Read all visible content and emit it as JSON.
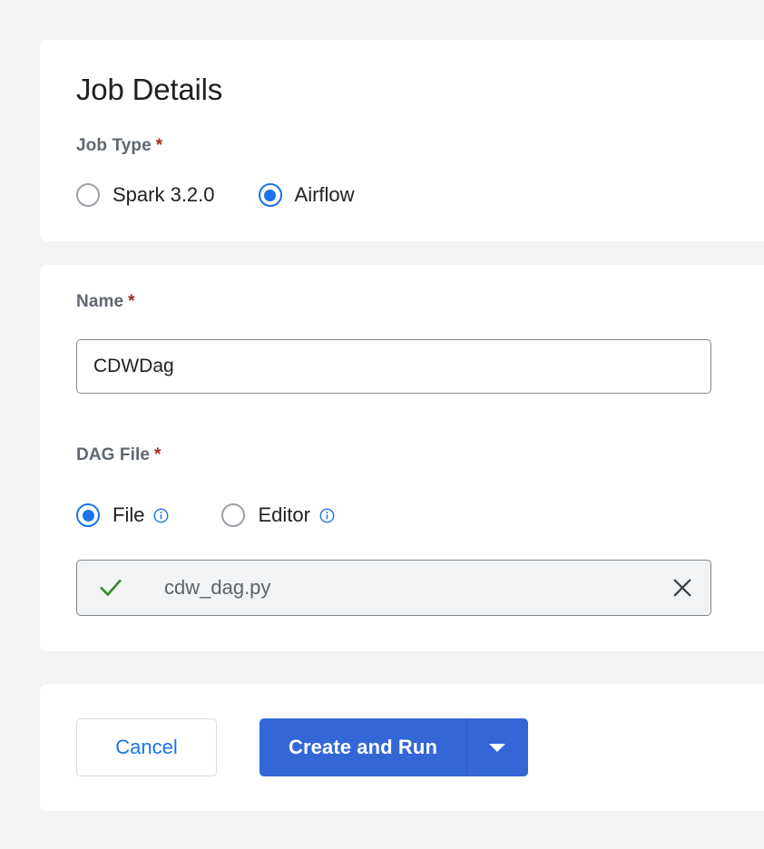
{
  "panel": {
    "title": "Job Details"
  },
  "job_type": {
    "label": "Job Type",
    "required_marker": "*",
    "options": [
      {
        "label": "Spark 3.2.0",
        "selected": false
      },
      {
        "label": "Airflow",
        "selected": true
      }
    ]
  },
  "name_field": {
    "label": "Name",
    "required_marker": "*",
    "value": "CDWDag",
    "placeholder": ""
  },
  "dag_file": {
    "label": "DAG File",
    "required_marker": "*",
    "options": [
      {
        "label": "File",
        "selected": true,
        "info_icon": "info-icon"
      },
      {
        "label": "Editor",
        "selected": false,
        "info_icon": "info-icon"
      }
    ],
    "uploaded": {
      "status_icon": "check-icon",
      "file_name": "cdw_dag.py",
      "remove_icon": "close-icon"
    }
  },
  "footer": {
    "cancel_label": "Cancel",
    "primary_label": "Create and Run",
    "dropdown_icon": "chevron-down-icon"
  },
  "colors": {
    "accent_blue": "#1a73e8",
    "primary_button": "#3367d6",
    "required_red": "#9c2a20",
    "success_green": "#3f8a34",
    "label_gray": "#5f6772",
    "page_background": "#f1f3f4"
  }
}
